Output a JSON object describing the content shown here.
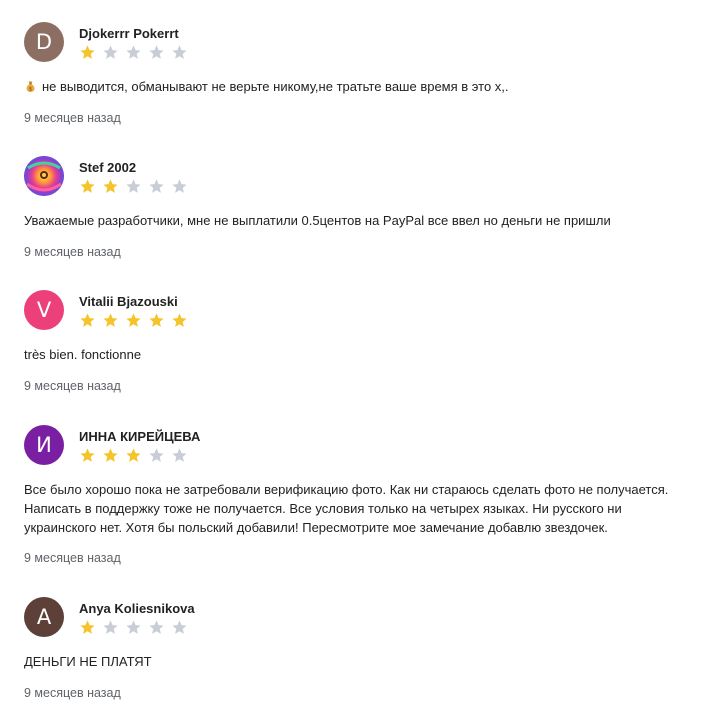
{
  "colors": {
    "star_filled": "#F5C42B",
    "star_empty": "#C9CDD6",
    "date_text": "#5f6368"
  },
  "reviews": [
    {
      "author": "Djokerrr Pokerrt",
      "avatar_letter": "D",
      "avatar_color": "#8D6E63",
      "rating": 1,
      "icon": "money-bag-icon",
      "text": "не выводится, обманывают не верьте никому,не тратьте ваше время в это х,.",
      "date": "9 месяцев назад"
    },
    {
      "author": "Stef 2002",
      "avatar_letter": "",
      "avatar_color": "#7B3FC4",
      "rating": 2,
      "text": "Уважаемые разработчики, мне не выплатили 0.5центов на PayPal все ввел но деньги не пришли",
      "date": "9 месяцев назад"
    },
    {
      "author": "Vitalii Bjazouski",
      "avatar_letter": "V",
      "avatar_color": "#EC407A",
      "rating": 5,
      "text": "très bien. fonctionne",
      "date": "9 месяцев назад"
    },
    {
      "author": "ИННА КИРЕЙЦЕВА",
      "avatar_letter": "И",
      "avatar_color": "#7B1FA2",
      "rating": 3,
      "text": "Все было хорошо пока не затребовали верификацию фото. Как ни стараюсь сделать фото не получается. Написать в поддержку тоже не получается. Все условия только на четырех языках. Ни русского ни украинского нет. Хотя бы польский добавили! Пересмотрите мое замечание добавлю звездочек.",
      "date": "9 месяцев назад"
    },
    {
      "author": "Anya Koliesnikova",
      "avatar_letter": "A",
      "avatar_color": "#5D4037",
      "rating": 1,
      "text": "ДЕНЬГИ НЕ ПЛАТЯТ",
      "date": "9 месяцев назад"
    }
  ]
}
